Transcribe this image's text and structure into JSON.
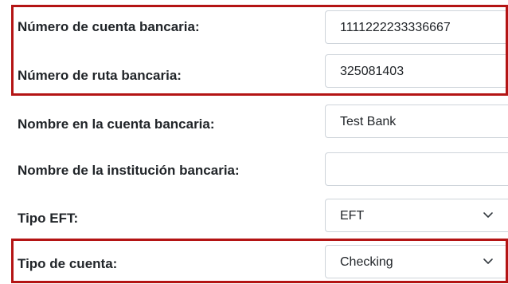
{
  "form": {
    "fields": [
      {
        "label": "Número de cuenta bancaria:",
        "value": "1111222233336667",
        "type": "text"
      },
      {
        "label": "Número de ruta bancaria:",
        "value": "325081403",
        "type": "text"
      },
      {
        "label": "Nombre en la cuenta bancaria:",
        "value": "Test Bank",
        "type": "text"
      },
      {
        "label": "Nombre de la institución bancaria:",
        "value": "",
        "type": "text"
      },
      {
        "label": "Tipo EFT:",
        "value": "EFT",
        "type": "select"
      },
      {
        "label": "Tipo de cuenta:",
        "value": "Checking",
        "type": "select"
      }
    ]
  },
  "highlight_color": "#b41414",
  "icons": {
    "select_arrow": "chevron-down-icon"
  }
}
